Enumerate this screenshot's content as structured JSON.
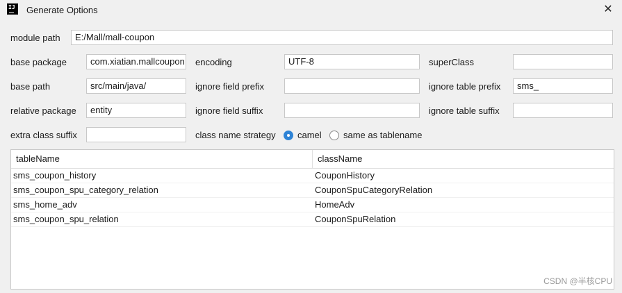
{
  "window": {
    "title": "Generate Options",
    "close_glyph": "✕",
    "app_icon": "IJ"
  },
  "module_path": {
    "label": "module path",
    "value": "E:/Mall/mall-coupon"
  },
  "base_package": {
    "label": "base package",
    "value": "com.xiatian.mallcoupon"
  },
  "encoding": {
    "label": "encoding",
    "value": "UTF-8"
  },
  "super_class": {
    "label": "superClass",
    "value": ""
  },
  "base_path": {
    "label": "base path",
    "value": "src/main/java/"
  },
  "ignore_field_prefix": {
    "label": "ignore field prefix",
    "value": ""
  },
  "ignore_table_prefix": {
    "label": "ignore table prefix",
    "value": "sms_"
  },
  "relative_package": {
    "label": "relative package",
    "value": "entity"
  },
  "ignore_field_suffix": {
    "label": "ignore field suffix",
    "value": ""
  },
  "ignore_table_suffix": {
    "label": "ignore table suffix",
    "value": ""
  },
  "extra_class_suffix": {
    "label": "extra class suffix",
    "value": ""
  },
  "class_name_strategy": {
    "label": "class name strategy",
    "options": [
      "camel",
      "same as tablename"
    ],
    "selected": "camel"
  },
  "table": {
    "headers": [
      "tableName",
      "className"
    ],
    "rows": [
      [
        "sms_coupon_history",
        "CouponHistory"
      ],
      [
        "sms_coupon_spu_category_relation",
        "CouponSpuCategoryRelation"
      ],
      [
        "sms_home_adv",
        "HomeAdv"
      ],
      [
        "sms_coupon_spu_relation",
        "CouponSpuRelation"
      ]
    ]
  },
  "watermark": "CSDN @半核CPU",
  "colors": {
    "accent": "#2f84d6",
    "background": "#f0f0f0"
  }
}
